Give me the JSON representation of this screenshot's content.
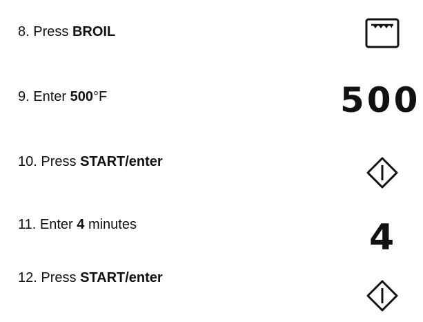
{
  "steps": [
    {
      "number": "8.",
      "prefix": "Press",
      "bold": "BROIL",
      "suffix": "",
      "icon": "broil-oven-icon"
    },
    {
      "number": "9.",
      "prefix": "Enter",
      "bold": "500",
      "suffix": "°F",
      "display": "500"
    },
    {
      "number": "10.",
      "prefix": "Press",
      "bold": "START/enter",
      "suffix": "",
      "icon": "start-diamond-icon"
    },
    {
      "number": "11.",
      "prefix": "Enter",
      "bold": "4",
      "suffix": "minutes",
      "display": "4"
    },
    {
      "number": "12.",
      "prefix": "Press",
      "bold": "START/enter",
      "suffix": "",
      "icon": "start-diamond-icon"
    }
  ],
  "colors": {
    "text": "#111111",
    "background": "#ffffff"
  }
}
